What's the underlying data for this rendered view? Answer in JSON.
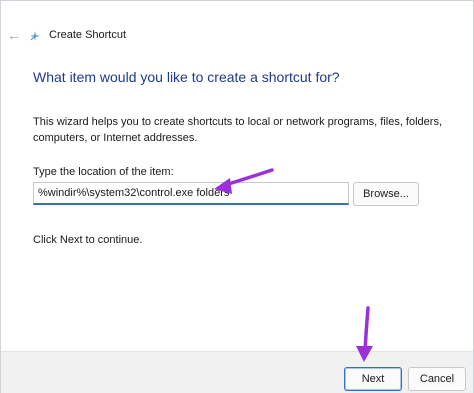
{
  "window": {
    "title": "Create Shortcut",
    "back_icon": "arrow-left-icon",
    "app_icon": "shortcut-sparkle-icon"
  },
  "main": {
    "heading": "What item would you like to create a shortcut for?",
    "description": "This wizard helps you to create shortcuts to local or network programs, files, folders, computers, or Internet addresses.",
    "location_label": "Type the location of the item:",
    "location_value": "%windir%\\system32\\control.exe folders",
    "browse_label": "Browse...",
    "continue_text": "Click Next to continue."
  },
  "footer": {
    "next_label": "Next",
    "cancel_label": "Cancel"
  },
  "colors": {
    "heading": "#1f3a8a",
    "accent": "#3c6fb5",
    "annotation_arrow": "#9b30d9"
  }
}
